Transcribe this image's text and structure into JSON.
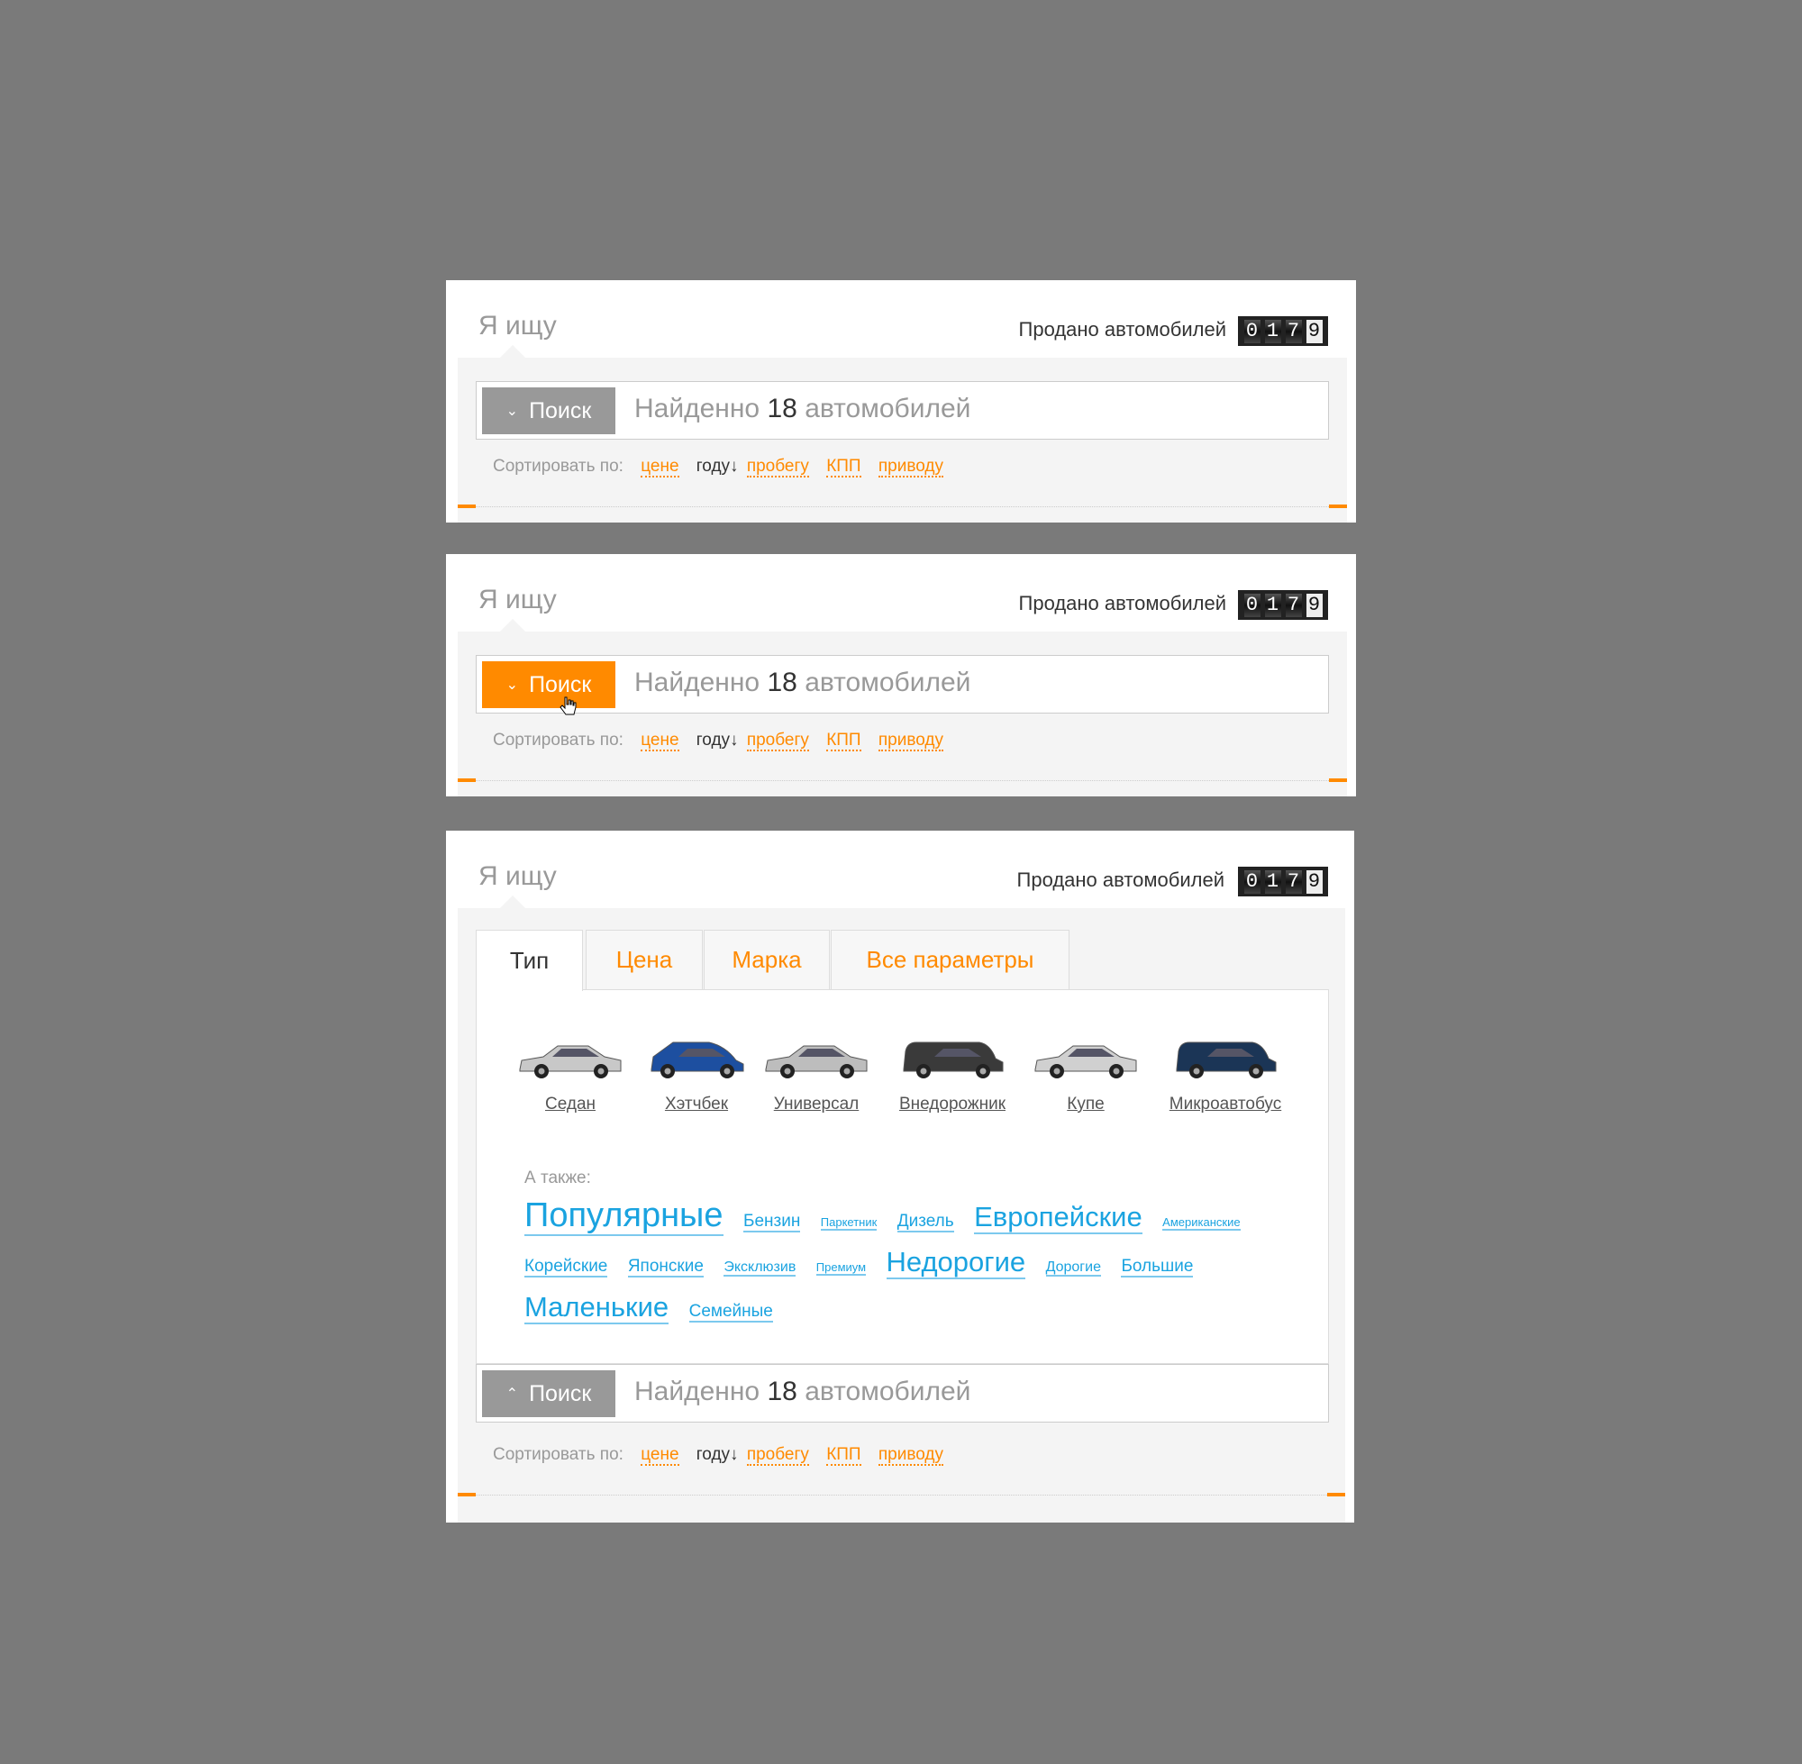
{
  "header": {
    "title": "Я ищу",
    "sold_label": "Продано автомобилей",
    "sold_digits": [
      "0",
      "1",
      "7",
      "9"
    ]
  },
  "search": {
    "button_label": "Поиск",
    "found_prefix": "Найденно",
    "found_count": "18",
    "found_suffix": "автомобилей"
  },
  "sort": {
    "label": "Сортировать по:",
    "options": [
      "цене",
      "году",
      "пробегу",
      "КПП",
      "приводу"
    ],
    "active": "году",
    "arrow": "↓"
  },
  "tabs": [
    "Тип",
    "Цена",
    "Марка",
    "Все параметры"
  ],
  "car_types": [
    {
      "label": "Седан",
      "color": "#c8c8c8"
    },
    {
      "label": "Хэтчбек",
      "color": "#1d4fa0"
    },
    {
      "label": "Универсал",
      "color": "#bdbdbd"
    },
    {
      "label": "Внедорожник",
      "color": "#3a3a3a"
    },
    {
      "label": "Купе",
      "color": "#d0d0d0"
    },
    {
      "label": "Микроавтобус",
      "color": "#1b3556"
    }
  ],
  "also_label": "А также:",
  "tags": [
    {
      "label": "Популярные",
      "size": "large"
    },
    {
      "label": "Бензин",
      "size": "medium"
    },
    {
      "label": "Паркетник",
      "size": "tiny"
    },
    {
      "label": "Дизель",
      "size": "medium"
    },
    {
      "label": "Европейские",
      "size": "big"
    },
    {
      "label": "Американские",
      "size": "tiny"
    },
    {
      "label": "Корейские",
      "size": "medium"
    },
    {
      "label": "Японские",
      "size": "medium"
    },
    {
      "label": "Эксклюзив",
      "size": "small"
    },
    {
      "label": "Премиум",
      "size": "tiny"
    },
    {
      "label": "Недорогие",
      "size": "big"
    },
    {
      "label": "Дорогие",
      "size": "small"
    },
    {
      "label": "Большие",
      "size": "medium"
    },
    {
      "label": "Маленькие",
      "size": "big"
    },
    {
      "label": "Семейные",
      "size": "medium"
    }
  ],
  "colors": {
    "accent": "#ff8a00",
    "link": "#1aa3e0",
    "button_idle": "#999999"
  }
}
